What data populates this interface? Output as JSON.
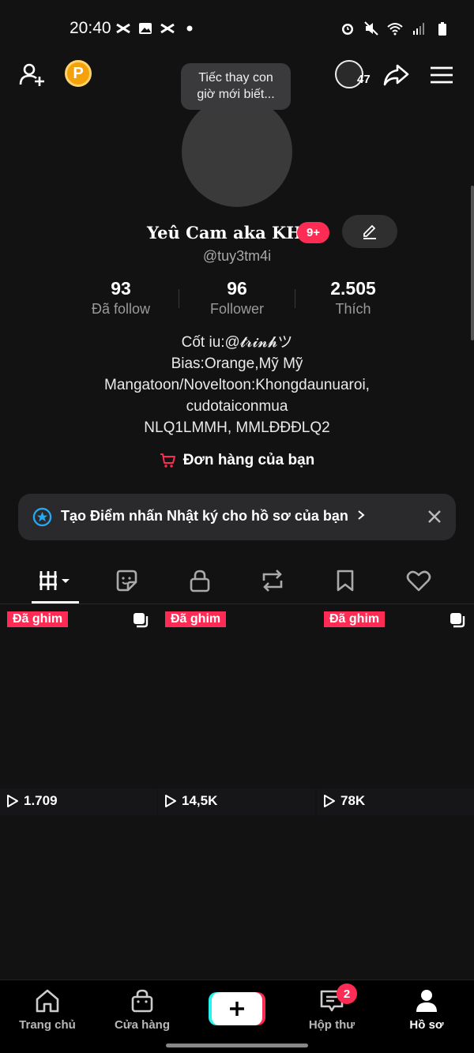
{
  "status_bar": {
    "time": "20:40"
  },
  "top_bar": {
    "coin_letter": "P",
    "story_count": "47"
  },
  "note": {
    "line1": "Tiếc thay con",
    "line2": "giờ mới biết..."
  },
  "profile": {
    "display_name": "Yeû Cam aka KHM",
    "notif_badge": "9+",
    "username": "@tuy3tm4i"
  },
  "stats": [
    {
      "value": "93",
      "label": "Đã follow"
    },
    {
      "value": "96",
      "label": "Follower"
    },
    {
      "value": "2.505",
      "label": "Thích"
    }
  ],
  "bio": [
    "Cốt iu:@𝓽𝓻𝓲𝓷𝓱ツ",
    "Bias:Orange,Mỹ Mỹ",
    "Mangatoon/Noveltoon:Khongdaunuaroi,",
    "cudotaiconmua",
    "NLQ1LMMH, MMLĐĐĐLQ2"
  ],
  "orders": {
    "label": "Đơn hàng của bạn"
  },
  "banner": {
    "text": "Tạo Điểm nhấn Nhật ký cho hồ sơ của bạn"
  },
  "tabs": [
    "videos-grid",
    "sticker",
    "private",
    "repost",
    "bookmark",
    "liked"
  ],
  "videos": [
    {
      "pinned": "Đã ghim",
      "views": "1.709"
    },
    {
      "pinned": "Đã ghim",
      "views": "14,5K"
    },
    {
      "pinned": "Đã ghim",
      "views": "78K"
    }
  ],
  "bottom_nav": {
    "home": "Trang chủ",
    "shop": "Cửa hàng",
    "inbox": "Hộp thư",
    "inbox_badge": "2",
    "profile": "Hồ sơ"
  },
  "colors": {
    "accent": "#fe2c55",
    "cyan": "#25f4ee",
    "background": "#121212"
  }
}
